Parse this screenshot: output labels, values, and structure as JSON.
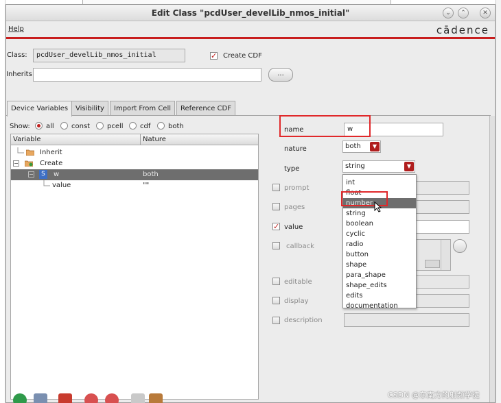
{
  "window": {
    "title": "Edit Class \"pcdUser_develLib_nmos_initial\""
  },
  "menu": {
    "help": "Help",
    "brand": "cādence"
  },
  "class_row": {
    "class_label": "Class:",
    "class_value": "pcdUser_develLib_nmos_initial",
    "create_cdf_label": "Create CDF",
    "create_cdf_checked": true
  },
  "inherits_row": {
    "label": "Inherits",
    "value": "",
    "browse_label": "..."
  },
  "tabs": [
    {
      "label": "Device Variables",
      "active": true
    },
    {
      "label": "Visibility"
    },
    {
      "label": "Import From Cell"
    },
    {
      "label": "Reference CDF"
    }
  ],
  "show": {
    "label": "Show:",
    "options": [
      "all",
      "const",
      "pcell",
      "cdf",
      "both"
    ],
    "selected": "all"
  },
  "tree": {
    "columns": [
      "Variable",
      "Nature"
    ],
    "rows": [
      {
        "label": "Inherit",
        "nature": ""
      },
      {
        "label": "Create",
        "nature": ""
      },
      {
        "label": "w",
        "nature": "both",
        "badge": "S"
      },
      {
        "label": "value",
        "nature": "\"\""
      }
    ]
  },
  "props": {
    "name_label": "name",
    "name_value": "w",
    "nature_label": "nature",
    "nature_value": "both",
    "type_label": "type",
    "type_value": "string",
    "prompt_label": "prompt",
    "pages_label": "pages",
    "value_label": "value",
    "callback_label": "callback",
    "editable_label": "editable",
    "display_label": "display",
    "description_label": "description"
  },
  "type_dropdown": {
    "options": [
      "int",
      "float",
      "number",
      "string",
      "boolean",
      "cyclic",
      "radio",
      "button",
      "shape",
      "para_shape",
      "shape_edits",
      "edits",
      "documentation"
    ],
    "highlighted": "number"
  },
  "watermark": "CSDN @东南方的射频学徒",
  "colors": {
    "accent_red": "#c81e1e",
    "highlight_box": "#e0282a",
    "selection": "#6e6e6e"
  }
}
